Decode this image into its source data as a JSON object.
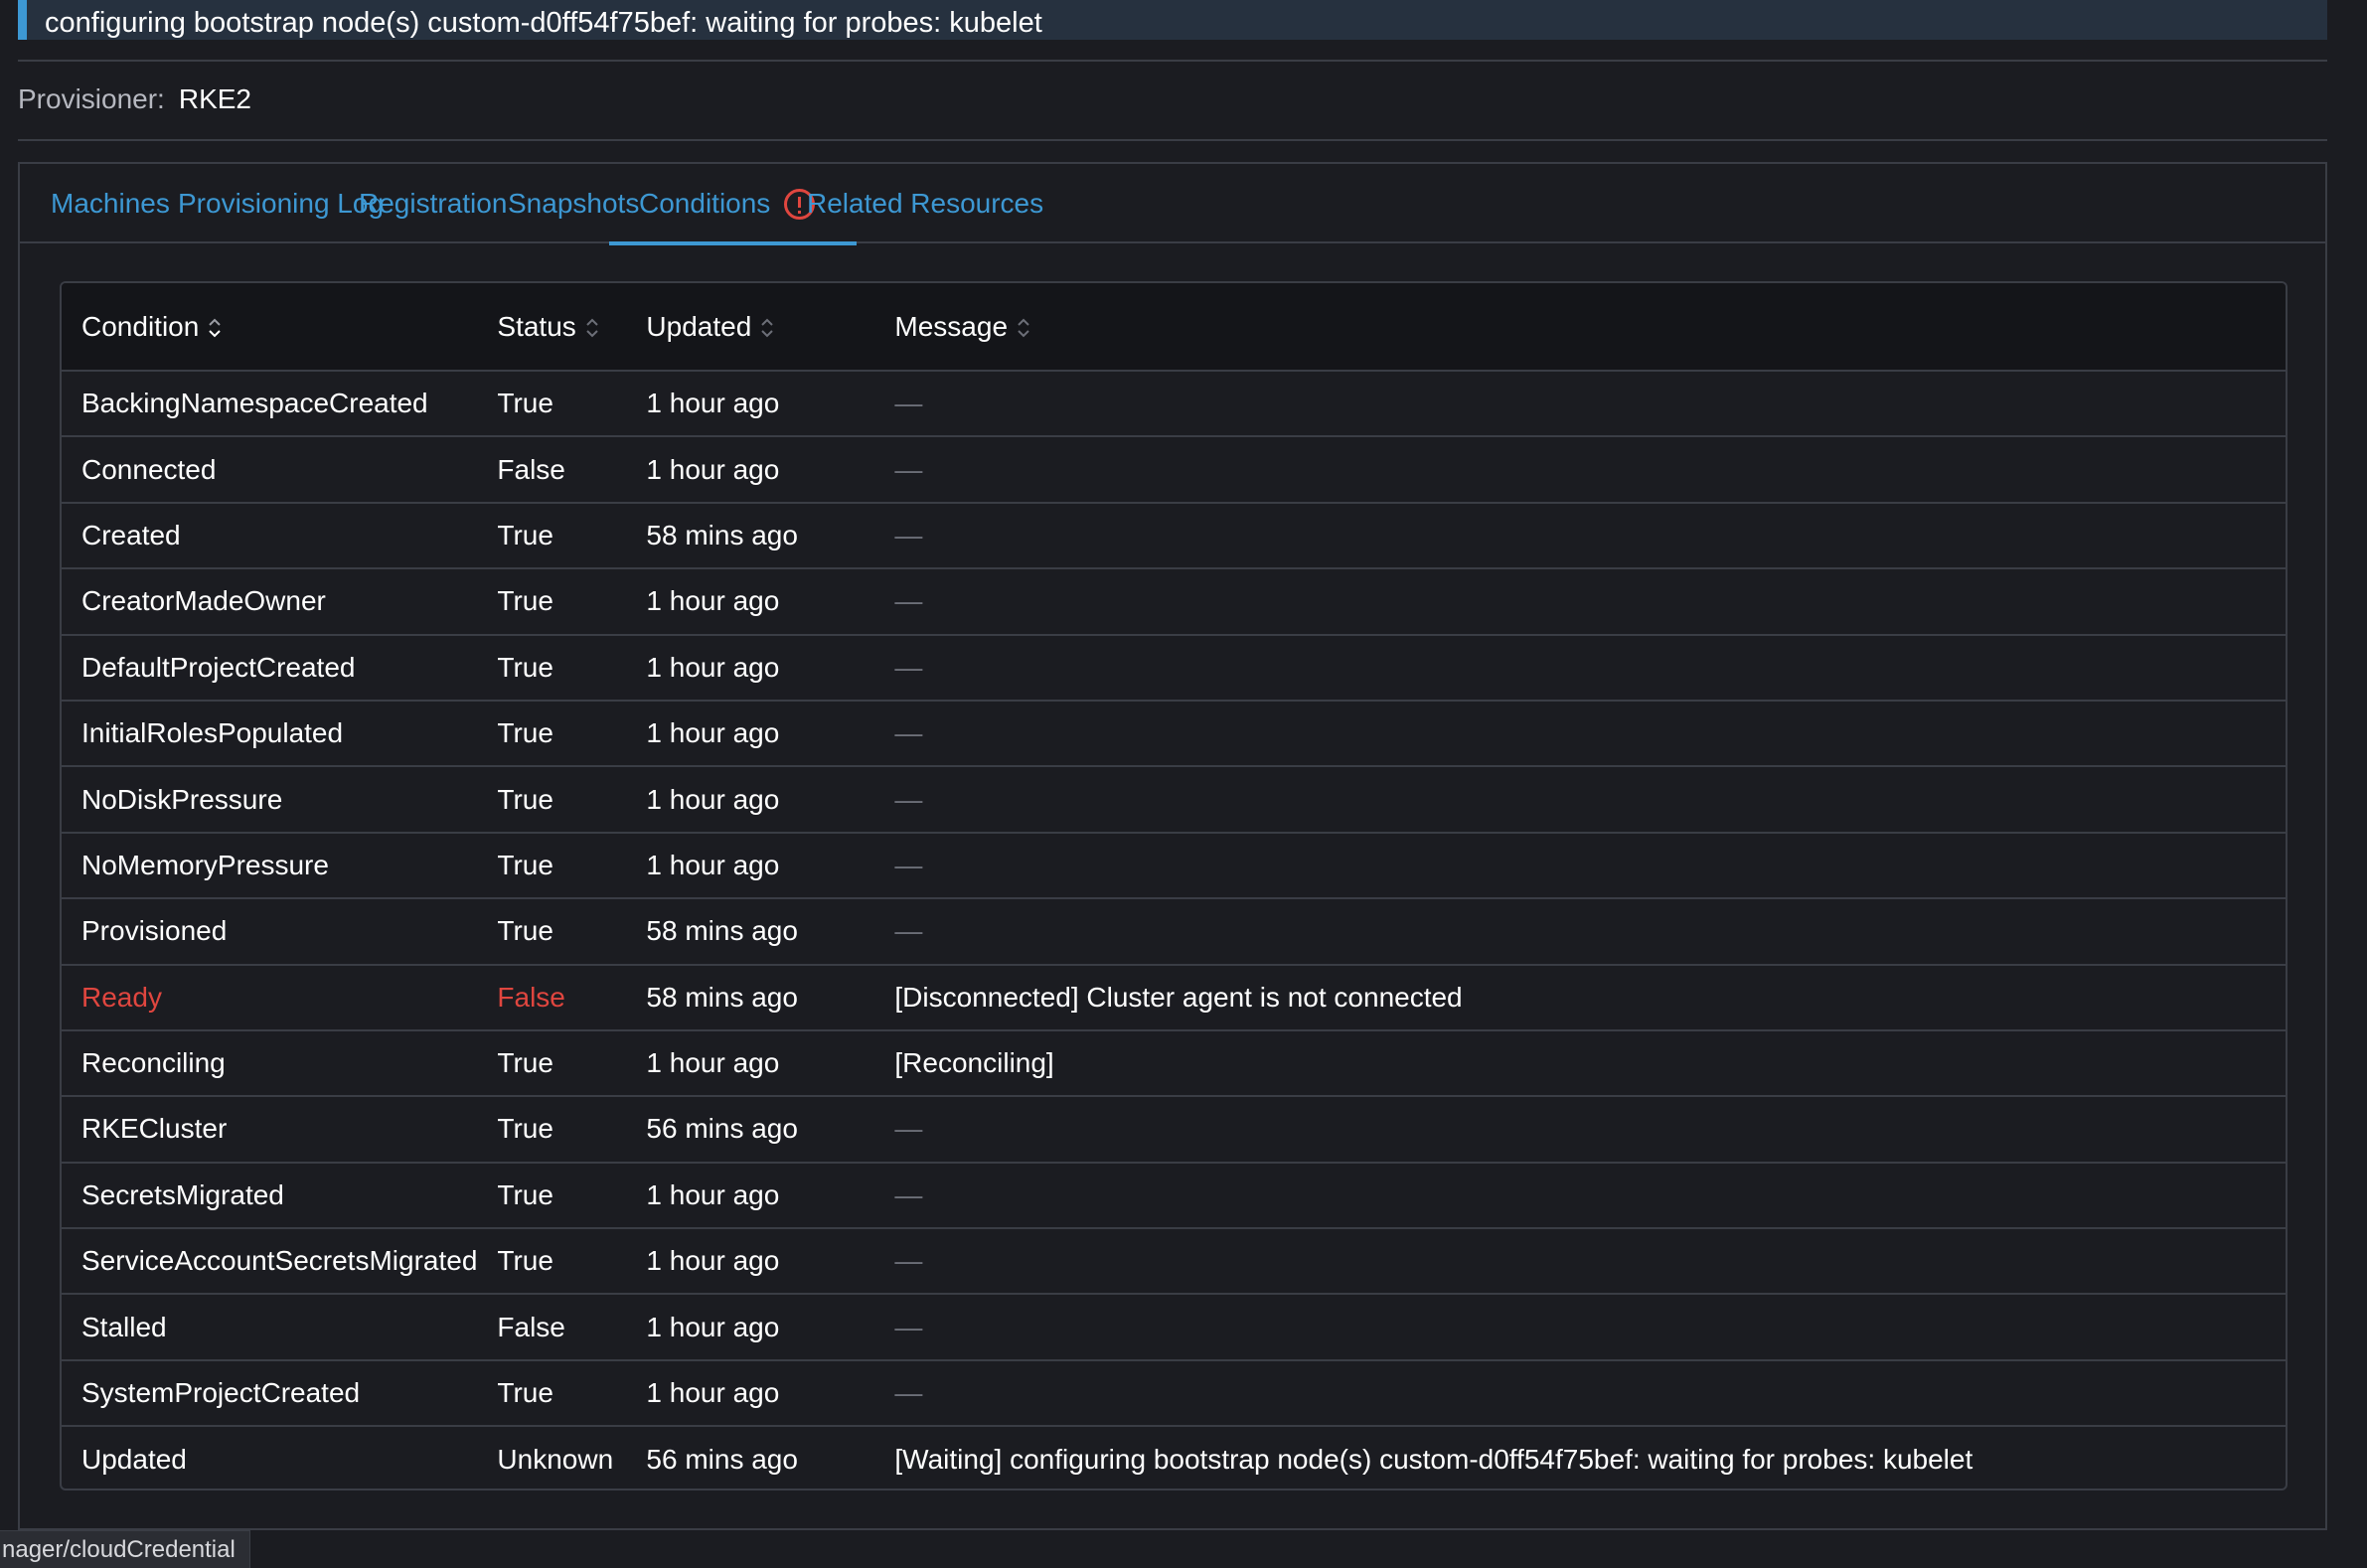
{
  "banner": {
    "text": "configuring bootstrap node(s) custom-d0ff54f75bef: waiting for probes: kubelet"
  },
  "provisioner": {
    "label": "Provisioner:",
    "value": "RKE2"
  },
  "tabs": [
    {
      "label": "Machines"
    },
    {
      "label": "Provisioning Log"
    },
    {
      "label": "Registration"
    },
    {
      "label": "Snapshots"
    },
    {
      "label": "Conditions",
      "active": true,
      "icon": "alert-circle-icon"
    },
    {
      "label": "Related Resources"
    }
  ],
  "table": {
    "headers": [
      "Condition",
      "Status",
      "Updated",
      "Message"
    ],
    "rows": [
      {
        "condition": "BackingNamespaceCreated",
        "status": "True",
        "updated": "1 hour ago",
        "message": "—"
      },
      {
        "condition": "Connected",
        "status": "False",
        "updated": "1 hour ago",
        "message": "—"
      },
      {
        "condition": "Created",
        "status": "True",
        "updated": "58 mins ago",
        "message": "—"
      },
      {
        "condition": "CreatorMadeOwner",
        "status": "True",
        "updated": "1 hour ago",
        "message": "—"
      },
      {
        "condition": "DefaultProjectCreated",
        "status": "True",
        "updated": "1 hour ago",
        "message": "—"
      },
      {
        "condition": "InitialRolesPopulated",
        "status": "True",
        "updated": "1 hour ago",
        "message": "—"
      },
      {
        "condition": "NoDiskPressure",
        "status": "True",
        "updated": "1 hour ago",
        "message": "—"
      },
      {
        "condition": "NoMemoryPressure",
        "status": "True",
        "updated": "1 hour ago",
        "message": "—"
      },
      {
        "condition": "Provisioned",
        "status": "True",
        "updated": "58 mins ago",
        "message": "—"
      },
      {
        "condition": "Ready",
        "status": "False",
        "updated": "58 mins ago",
        "message": "[Disconnected] Cluster agent is not connected",
        "error": true
      },
      {
        "condition": "Reconciling",
        "status": "True",
        "updated": "1 hour ago",
        "message": "[Reconciling]"
      },
      {
        "condition": "RKECluster",
        "status": "True",
        "updated": "56 mins ago",
        "message": "—"
      },
      {
        "condition": "SecretsMigrated",
        "status": "True",
        "updated": "1 hour ago",
        "message": "—"
      },
      {
        "condition": "ServiceAccountSecretsMigrated",
        "status": "True",
        "updated": "1 hour ago",
        "message": "—"
      },
      {
        "condition": "Stalled",
        "status": "False",
        "updated": "1 hour ago",
        "message": "—"
      },
      {
        "condition": "SystemProjectCreated",
        "status": "True",
        "updated": "1 hour ago",
        "message": "—"
      },
      {
        "condition": "Updated",
        "status": "Unknown",
        "updated": "56 mins ago",
        "message": "[Waiting] configuring bootstrap node(s) custom-d0ff54f75bef: waiting for probes: kubelet"
      }
    ]
  },
  "statusbar": {
    "text": "nager/cloudCredential"
  },
  "colors": {
    "accent": "#3d98d3",
    "error": "#e0463f",
    "background": "#1b1c21",
    "header_bg": "#141519",
    "border": "#3a3d45"
  }
}
